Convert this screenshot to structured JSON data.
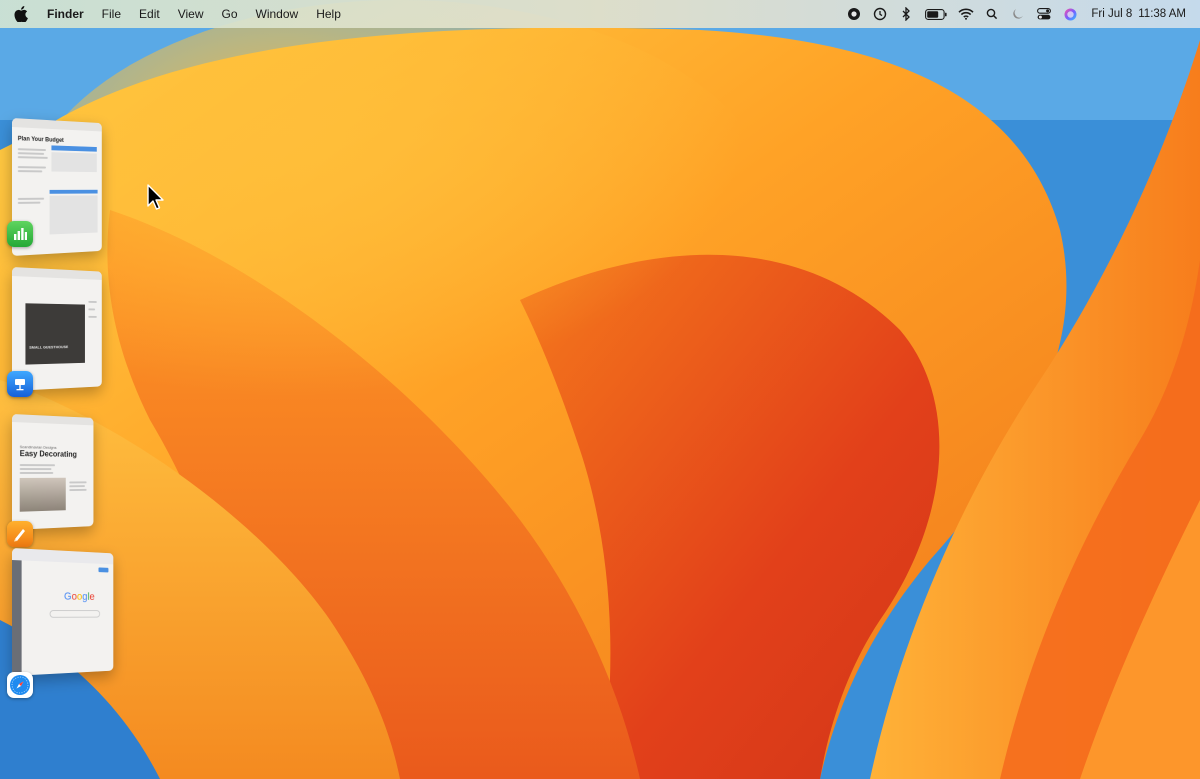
{
  "menubar": {
    "app_name": "Finder",
    "items": [
      "File",
      "Edit",
      "View",
      "Go",
      "Window",
      "Help"
    ],
    "status_icons": [
      "screen-record-icon",
      "time-machine-icon",
      "bluetooth-icon",
      "battery-icon",
      "wifi-icon",
      "spotlight-search-icon",
      "focus-moon-icon",
      "control-center-icon",
      "siri-icon"
    ],
    "date": "Fri Jul 8",
    "time": "11:38 AM"
  },
  "stage_manager": {
    "windows": [
      {
        "app": "Numbers",
        "icon": "numbers-app-icon",
        "doc_title": "Plan Your Budget"
      },
      {
        "app": "Keynote",
        "icon": "keynote-app-icon",
        "doc_title": "SMALL GUESTHOUSE"
      },
      {
        "app": "Pages",
        "icon": "pages-app-icon",
        "doc_title": "Easy Decorating",
        "doc_subtitle": "Scandinavian Designs"
      },
      {
        "app": "Safari",
        "icon": "safari-app-icon",
        "doc_title": "Google"
      }
    ]
  },
  "colors": {
    "wallpaper_orange": "#f39a1e",
    "wallpaper_deep": "#e4461c",
    "wallpaper_blue": "#3a8fd8"
  }
}
